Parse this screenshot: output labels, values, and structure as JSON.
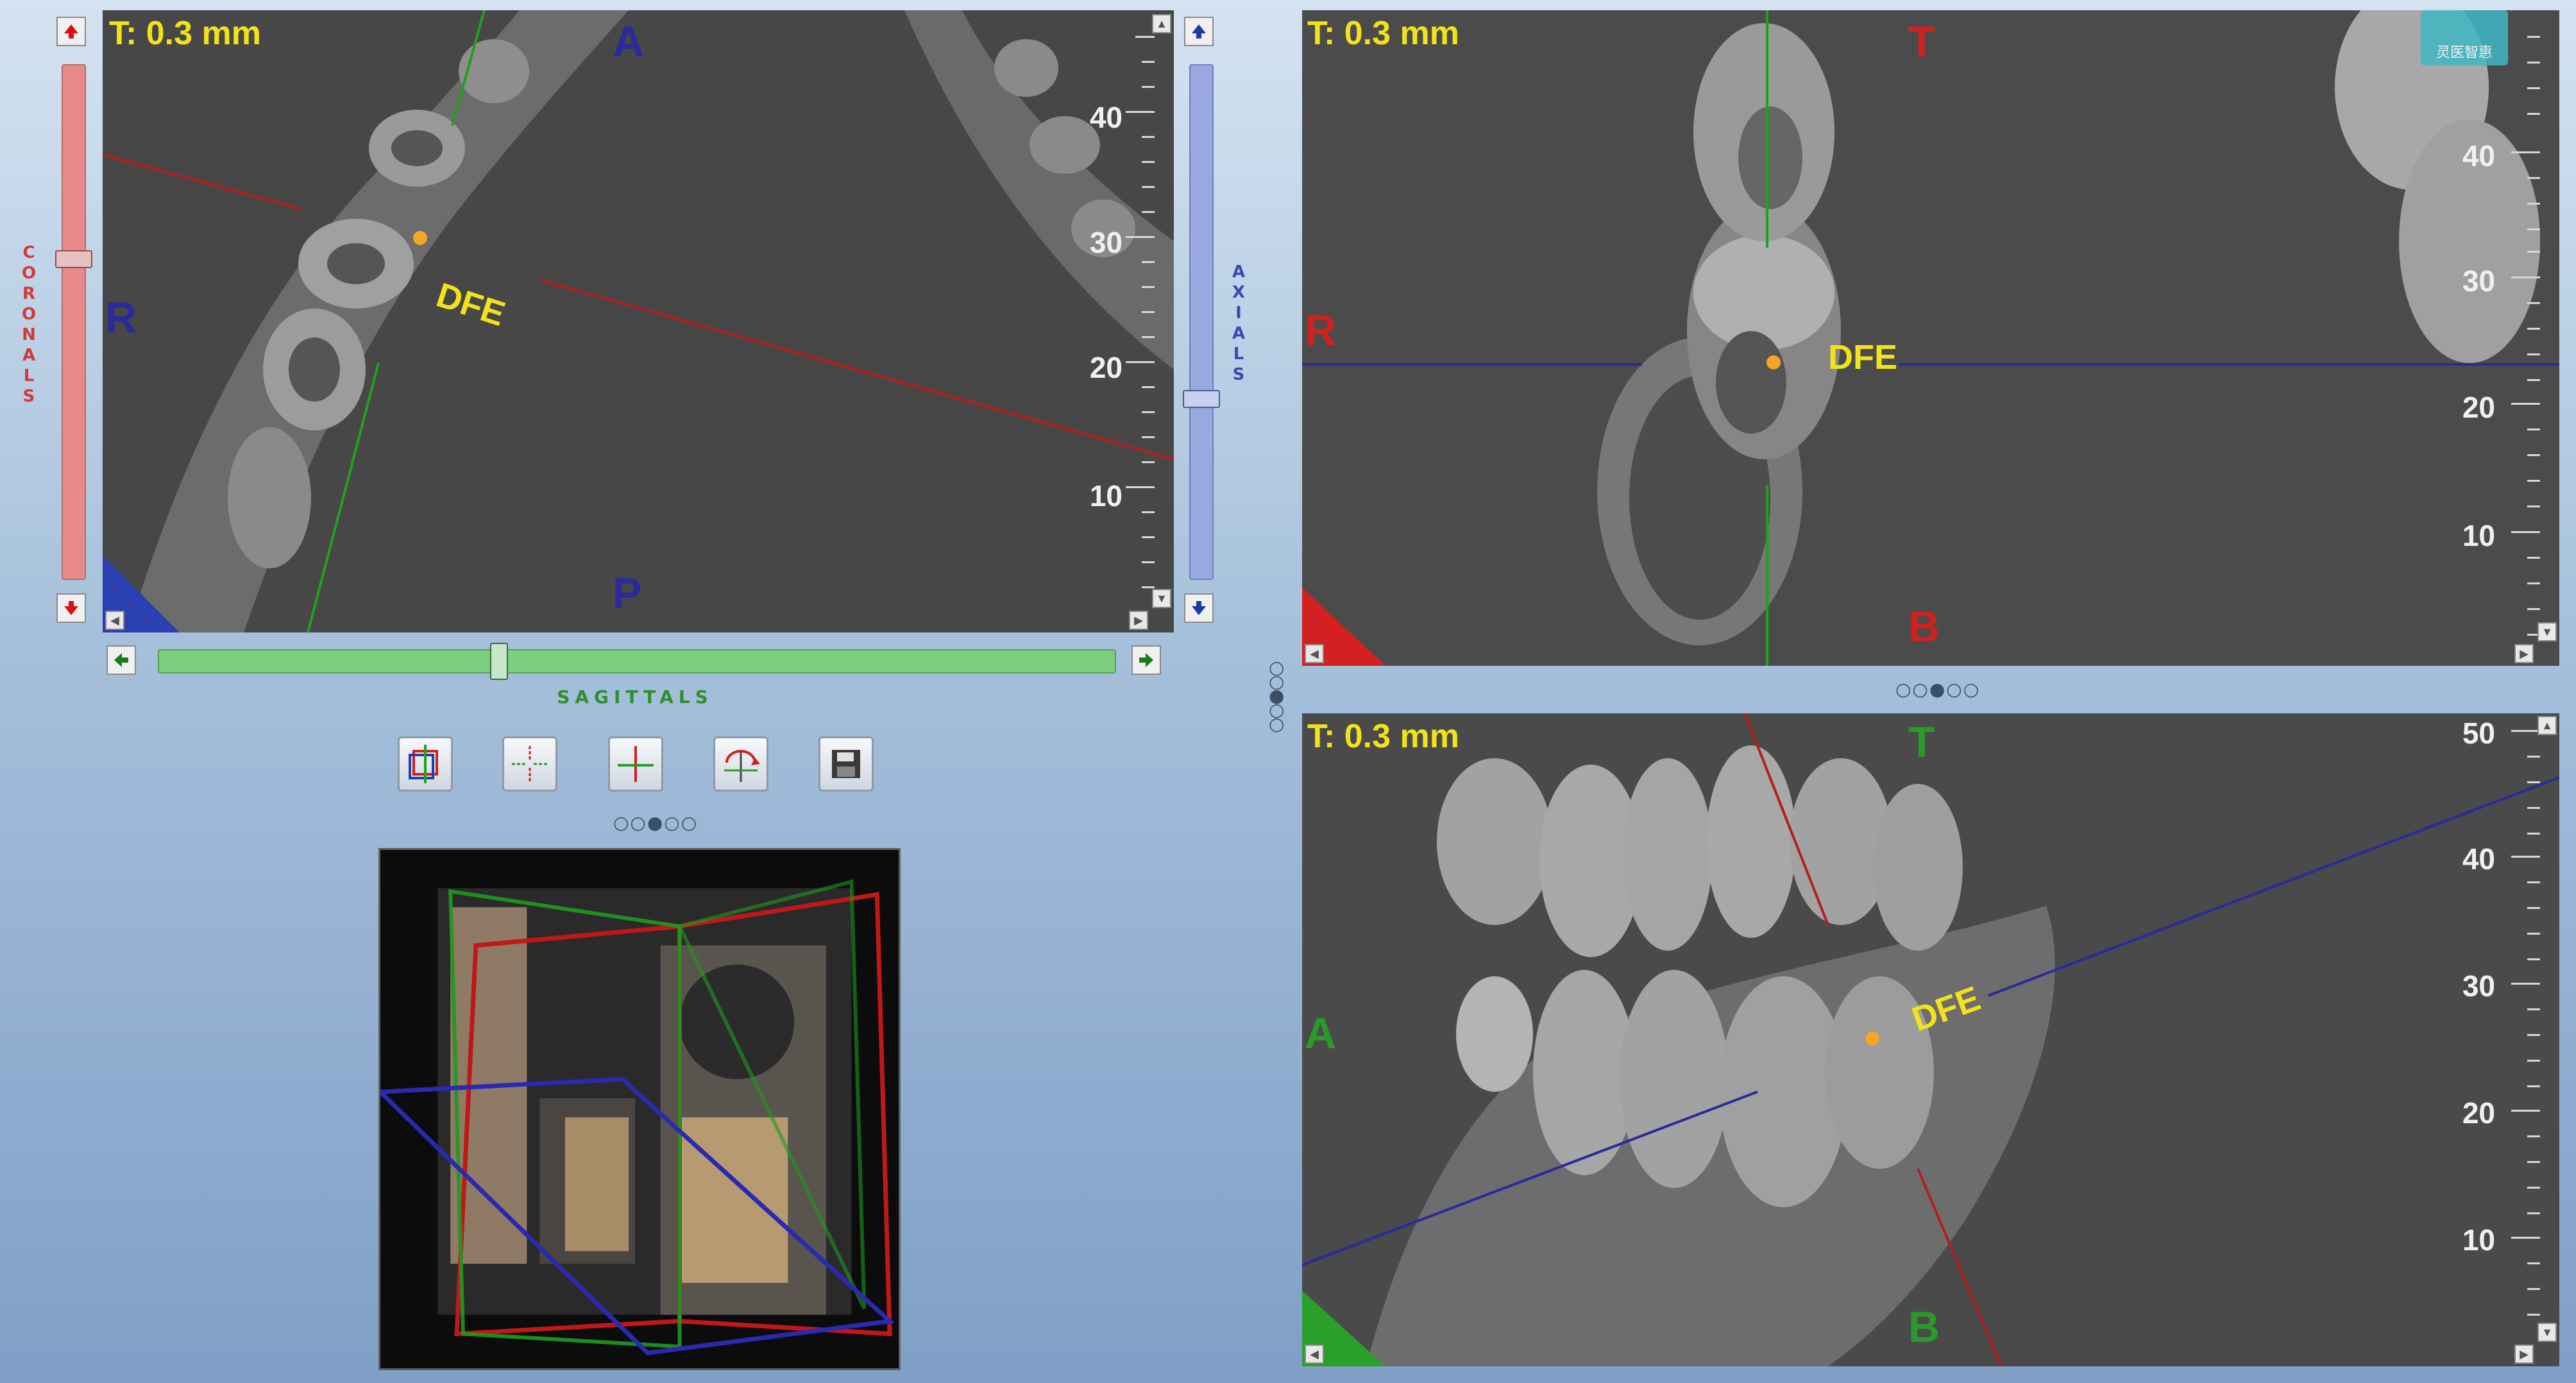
{
  "colors": {
    "tooth_label": "#f2e21a",
    "axial_line": "#2a2aa6",
    "coronal_line": "#c02020",
    "sagittal_line": "#20a020",
    "coronal_slider": "#e88a8a",
    "axial_slider": "#9aa8e0",
    "sagittal_slider": "#7ccf7c"
  },
  "axial_view": {
    "thickness": "T: 0.3 mm",
    "orient_top": "A",
    "orient_left": "R",
    "orient_bottom": "P",
    "marker": "DFE",
    "ruler": [
      "40",
      "30",
      "20",
      "10"
    ]
  },
  "coronal_view": {
    "thickness": "T: 0.3 mm",
    "orient_top": "T",
    "orient_left": "R",
    "orient_bottom": "B",
    "marker": "DFE",
    "ruler": [
      "40",
      "30",
      "20",
      "10"
    ]
  },
  "sagittal_view": {
    "thickness": "T: 0.3 mm",
    "orient_top": "T",
    "orient_left": "A",
    "orient_bottom": "B",
    "marker": "DFE",
    "ruler": [
      "50",
      "40",
      "30",
      "20",
      "10"
    ]
  },
  "sliders": {
    "coronals_label": "CORONALS",
    "axials_label": "AXIALS",
    "sagittals_label": "SAGITTALS",
    "coronal_position": 0.38,
    "axial_position": 0.65,
    "sagittal_position": 0.36
  },
  "toolbar": {
    "icons": [
      "reset-view-icon",
      "crosshair-icon",
      "crosshair-lock-icon",
      "rotate-icon",
      "save-icon"
    ]
  },
  "watermark": {
    "text": "灵医智惠"
  },
  "splitters": {
    "horizontal": "○○●○○",
    "vertical": "○○●○○"
  }
}
